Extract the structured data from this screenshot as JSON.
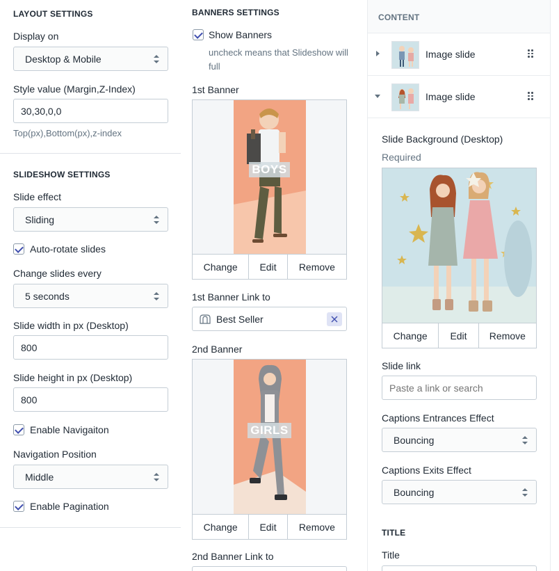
{
  "layout": {
    "title": "LAYOUT SETTINGS",
    "display_label": "Display on",
    "display_value": "Desktop & Mobile",
    "style_label": "Style value (Margin,Z-Index)",
    "style_value": "30,30,0,0",
    "style_hint": "Top(px),Bottom(px),z-index"
  },
  "slideshow": {
    "title": "SLIDESHOW SETTINGS",
    "effect_label": "Slide effect",
    "effect_value": "Sliding",
    "autorotate_label": "Auto-rotate slides",
    "change_label": "Change slides every",
    "change_value": "5 seconds",
    "width_label": "Slide width in px (Desktop)",
    "width_value": "800",
    "height_label": "Slide height in px (Desktop)",
    "height_value": "800",
    "navigation_label": "Enable Navigaiton",
    "nav_position_label": "Navigation Position",
    "nav_position_value": "Middle",
    "pagination_label": "Enable Pagination"
  },
  "banners": {
    "title": "BANNERS SETTINGS",
    "show_label": "Show Banners",
    "show_hint": "uncheck means that Slideshow will full",
    "banner1_label": "1st Banner",
    "banner1_caption": "BOYS",
    "banner1_link_label": "1st Banner Link to",
    "banner1_link_value": "Best Seller",
    "banner2_label": "2nd Banner",
    "banner2_caption": "GIRLS",
    "banner2_link_label": "2nd Banner Link to",
    "change": "Change",
    "edit": "Edit",
    "remove": "Remove"
  },
  "content": {
    "title": "CONTENT",
    "slides": [
      {
        "label": "Image slide"
      },
      {
        "label": "Image slide"
      }
    ],
    "bg_label": "Slide Background (Desktop)",
    "bg_required": "Required",
    "change": "Change",
    "edit": "Edit",
    "remove": "Remove",
    "link_label": "Slide link",
    "link_placeholder": "Paste a link or search",
    "entrance_label": "Captions Entrances Effect",
    "entrance_value": "Bouncing",
    "exit_label": "Captions Exits Effect",
    "exit_value": "Bouncing",
    "title_section": "TITLE",
    "title_label": "Title"
  },
  "colors": {
    "accent": "#3f4eae",
    "border": "#c4cdd5",
    "muted_text": "#637381",
    "banner_bg": "#f2a483",
    "slide_bg": "#cfe3e8"
  }
}
